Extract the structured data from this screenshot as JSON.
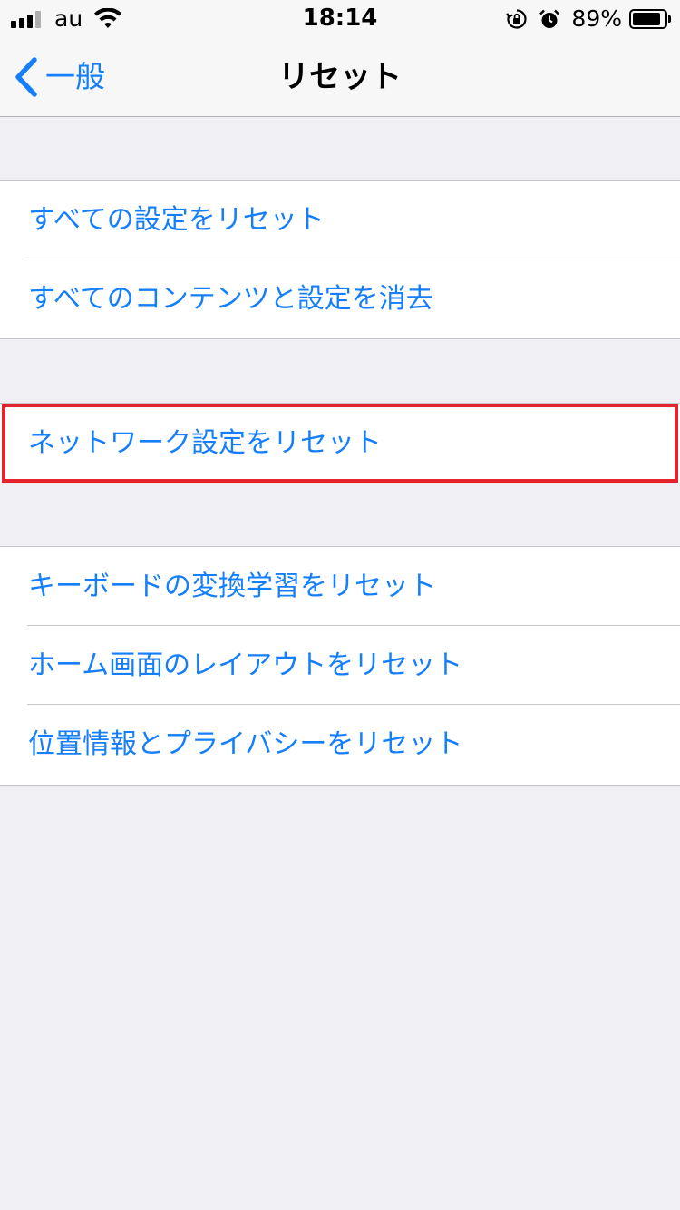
{
  "status_bar": {
    "carrier": "au",
    "time": "18:14",
    "battery_percent": "89%",
    "battery_level": 0.89,
    "icons": [
      "signal-icon",
      "wifi-icon",
      "rotation-lock-icon",
      "alarm-icon",
      "battery-icon"
    ]
  },
  "nav": {
    "back_label": "一般",
    "title": "リセット"
  },
  "groups": {
    "g1": {
      "items": [
        {
          "label": "すべての設定をリセット"
        },
        {
          "label": "すべてのコンテンツと設定を消去"
        }
      ]
    },
    "g2": {
      "items": [
        {
          "label": "ネットワーク設定をリセット",
          "highlighted": true
        }
      ]
    },
    "g3": {
      "items": [
        {
          "label": "キーボードの変換学習をリセット"
        },
        {
          "label": "ホーム画面のレイアウトをリセット"
        },
        {
          "label": "位置情報とプライバシーをリセット"
        }
      ]
    }
  },
  "colors": {
    "accent": "#157efb",
    "background": "#efeff4",
    "highlight_border": "#e5242c"
  }
}
